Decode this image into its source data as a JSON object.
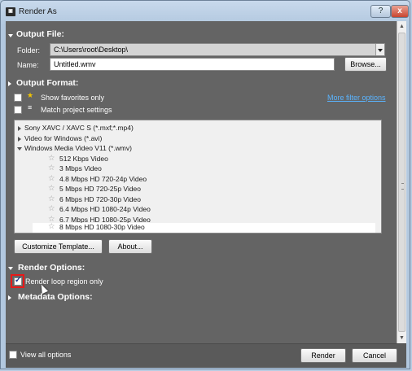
{
  "window": {
    "title": "Render As",
    "help_label": "?",
    "close_label": "x"
  },
  "output_file": {
    "title": "Output File:",
    "folder_label": "Folder:",
    "folder_value": "C:\\Users\\root\\Desktop\\",
    "name_label": "Name:",
    "name_value": "Untitled.wmv",
    "browse_label": "Browse..."
  },
  "output_format": {
    "title": "Output Format:",
    "show_favorites_label": "Show favorites only",
    "match_project_label": "Match project settings",
    "more_filter_label": "More filter options"
  },
  "format_list": {
    "groups": [
      {
        "label": "Sony XAVC / XAVC S (*.mxf;*.mp4)",
        "expanded": false
      },
      {
        "label": "Video for Windows (*.avi)",
        "expanded": false
      },
      {
        "label": "Windows Media Video V11 (*.wmv)",
        "expanded": true
      }
    ],
    "templates": [
      {
        "label": "512 Kbps Video"
      },
      {
        "label": "3 Mbps Video"
      },
      {
        "label": "4.8 Mbps HD 720-24p Video"
      },
      {
        "label": "5 Mbps HD 720-25p Video"
      },
      {
        "label": "6 Mbps HD 720-30p Video"
      },
      {
        "label": "6.4 Mbps HD 1080-24p Video"
      },
      {
        "label": "6.7 Mbps HD 1080-25p Video"
      },
      {
        "label": "8 Mbps HD 1080-30p Video",
        "selected": true
      }
    ]
  },
  "actions": {
    "customize_label": "Customize Template...",
    "about_label": "About..."
  },
  "render_options": {
    "title": "Render Options:",
    "loop_region_label": "Render loop region only",
    "loop_region_checked": true
  },
  "metadata_options": {
    "title": "Metadata Options:"
  },
  "footer": {
    "view_all_label": "View all options",
    "render_label": "Render",
    "cancel_label": "Cancel"
  },
  "icons": {
    "app": "render-app-icon",
    "star": "star-icon",
    "match_project": "match-project-icon"
  }
}
